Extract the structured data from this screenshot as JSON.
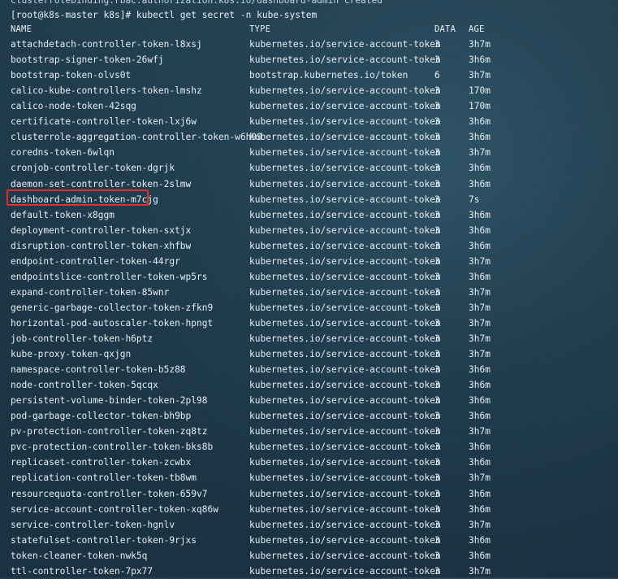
{
  "terminal": {
    "truncated_previous_line": "clusterrolebinding.rbac.authorization.k8s.io/dashboard-admin created",
    "prompt": "[root@k8s-master k8s]# kubectl get secret -n kube-system",
    "headers": {
      "name": "NAME",
      "type": "TYPE",
      "data": "DATA",
      "age": "AGE"
    },
    "highlight_color": "#e0302b",
    "rows": [
      {
        "name": "attachdetach-controller-token-l8xsj",
        "type": "kubernetes.io/service-account-token",
        "data": "3",
        "age": "3h7m"
      },
      {
        "name": "bootstrap-signer-token-26wfj",
        "type": "kubernetes.io/service-account-token",
        "data": "3",
        "age": "3h6m"
      },
      {
        "name": "bootstrap-token-olvs0t",
        "type": "bootstrap.kubernetes.io/token",
        "data": "6",
        "age": "3h7m"
      },
      {
        "name": "calico-kube-controllers-token-lmshz",
        "type": "kubernetes.io/service-account-token",
        "data": "3",
        "age": "170m"
      },
      {
        "name": "calico-node-token-42sqg",
        "type": "kubernetes.io/service-account-token",
        "data": "3",
        "age": "170m"
      },
      {
        "name": "certificate-controller-token-lxj6w",
        "type": "kubernetes.io/service-account-token",
        "data": "3",
        "age": "3h6m"
      },
      {
        "name": "clusterrole-aggregation-controller-token-w6h99",
        "type": "kubernetes.io/service-account-token",
        "data": "3",
        "age": "3h6m"
      },
      {
        "name": "coredns-token-6wlqn",
        "type": "kubernetes.io/service-account-token",
        "data": "3",
        "age": "3h7m"
      },
      {
        "name": "cronjob-controller-token-dgrjk",
        "type": "kubernetes.io/service-account-token",
        "data": "3",
        "age": "3h6m"
      },
      {
        "name": "daemon-set-controller-token-2slmw",
        "type": "kubernetes.io/service-account-token",
        "data": "3",
        "age": "3h6m"
      },
      {
        "name": "dashboard-admin-token-m7cjg",
        "type": "kubernetes.io/service-account-token",
        "data": "3",
        "age": "7s"
      },
      {
        "name": "default-token-x8ggm",
        "type": "kubernetes.io/service-account-token",
        "data": "3",
        "age": "3h6m"
      },
      {
        "name": "deployment-controller-token-sxtjx",
        "type": "kubernetes.io/service-account-token",
        "data": "3",
        "age": "3h6m"
      },
      {
        "name": "disruption-controller-token-xhfbw",
        "type": "kubernetes.io/service-account-token",
        "data": "3",
        "age": "3h6m"
      },
      {
        "name": "endpoint-controller-token-44rgr",
        "type": "kubernetes.io/service-account-token",
        "data": "3",
        "age": "3h7m"
      },
      {
        "name": "endpointslice-controller-token-wp5rs",
        "type": "kubernetes.io/service-account-token",
        "data": "3",
        "age": "3h6m"
      },
      {
        "name": "expand-controller-token-85wnr",
        "type": "kubernetes.io/service-account-token",
        "data": "3",
        "age": "3h7m"
      },
      {
        "name": "generic-garbage-collector-token-zfkn9",
        "type": "kubernetes.io/service-account-token",
        "data": "3",
        "age": "3h7m"
      },
      {
        "name": "horizontal-pod-autoscaler-token-hpngt",
        "type": "kubernetes.io/service-account-token",
        "data": "3",
        "age": "3h7m"
      },
      {
        "name": "job-controller-token-h6ptz",
        "type": "kubernetes.io/service-account-token",
        "data": "3",
        "age": "3h7m"
      },
      {
        "name": "kube-proxy-token-qxjgn",
        "type": "kubernetes.io/service-account-token",
        "data": "3",
        "age": "3h7m"
      },
      {
        "name": "namespace-controller-token-b5z88",
        "type": "kubernetes.io/service-account-token",
        "data": "3",
        "age": "3h6m"
      },
      {
        "name": "node-controller-token-5qcqx",
        "type": "kubernetes.io/service-account-token",
        "data": "3",
        "age": "3h6m"
      },
      {
        "name": "persistent-volume-binder-token-2pl98",
        "type": "kubernetes.io/service-account-token",
        "data": "3",
        "age": "3h6m"
      },
      {
        "name": "pod-garbage-collector-token-bh9bp",
        "type": "kubernetes.io/service-account-token",
        "data": "3",
        "age": "3h6m"
      },
      {
        "name": "pv-protection-controller-token-zq8tz",
        "type": "kubernetes.io/service-account-token",
        "data": "3",
        "age": "3h7m"
      },
      {
        "name": "pvc-protection-controller-token-bks8b",
        "type": "kubernetes.io/service-account-token",
        "data": "3",
        "age": "3h6m"
      },
      {
        "name": "replicaset-controller-token-zcwbx",
        "type": "kubernetes.io/service-account-token",
        "data": "3",
        "age": "3h6m"
      },
      {
        "name": "replication-controller-token-tb8wm",
        "type": "kubernetes.io/service-account-token",
        "data": "3",
        "age": "3h7m"
      },
      {
        "name": "resourcequota-controller-token-659v7",
        "type": "kubernetes.io/service-account-token",
        "data": "3",
        "age": "3h6m"
      },
      {
        "name": "service-account-controller-token-xq86w",
        "type": "kubernetes.io/service-account-token",
        "data": "3",
        "age": "3h6m"
      },
      {
        "name": "service-controller-token-hgnlv",
        "type": "kubernetes.io/service-account-token",
        "data": "3",
        "age": "3h7m"
      },
      {
        "name": "statefulset-controller-token-9rjxs",
        "type": "kubernetes.io/service-account-token",
        "data": "3",
        "age": "3h6m"
      },
      {
        "name": "token-cleaner-token-nwk5q",
        "type": "kubernetes.io/service-account-token",
        "data": "3",
        "age": "3h6m"
      },
      {
        "name": "ttl-controller-token-7px77",
        "type": "kubernetes.io/service-account-token",
        "data": "3",
        "age": "3h7m"
      }
    ]
  }
}
